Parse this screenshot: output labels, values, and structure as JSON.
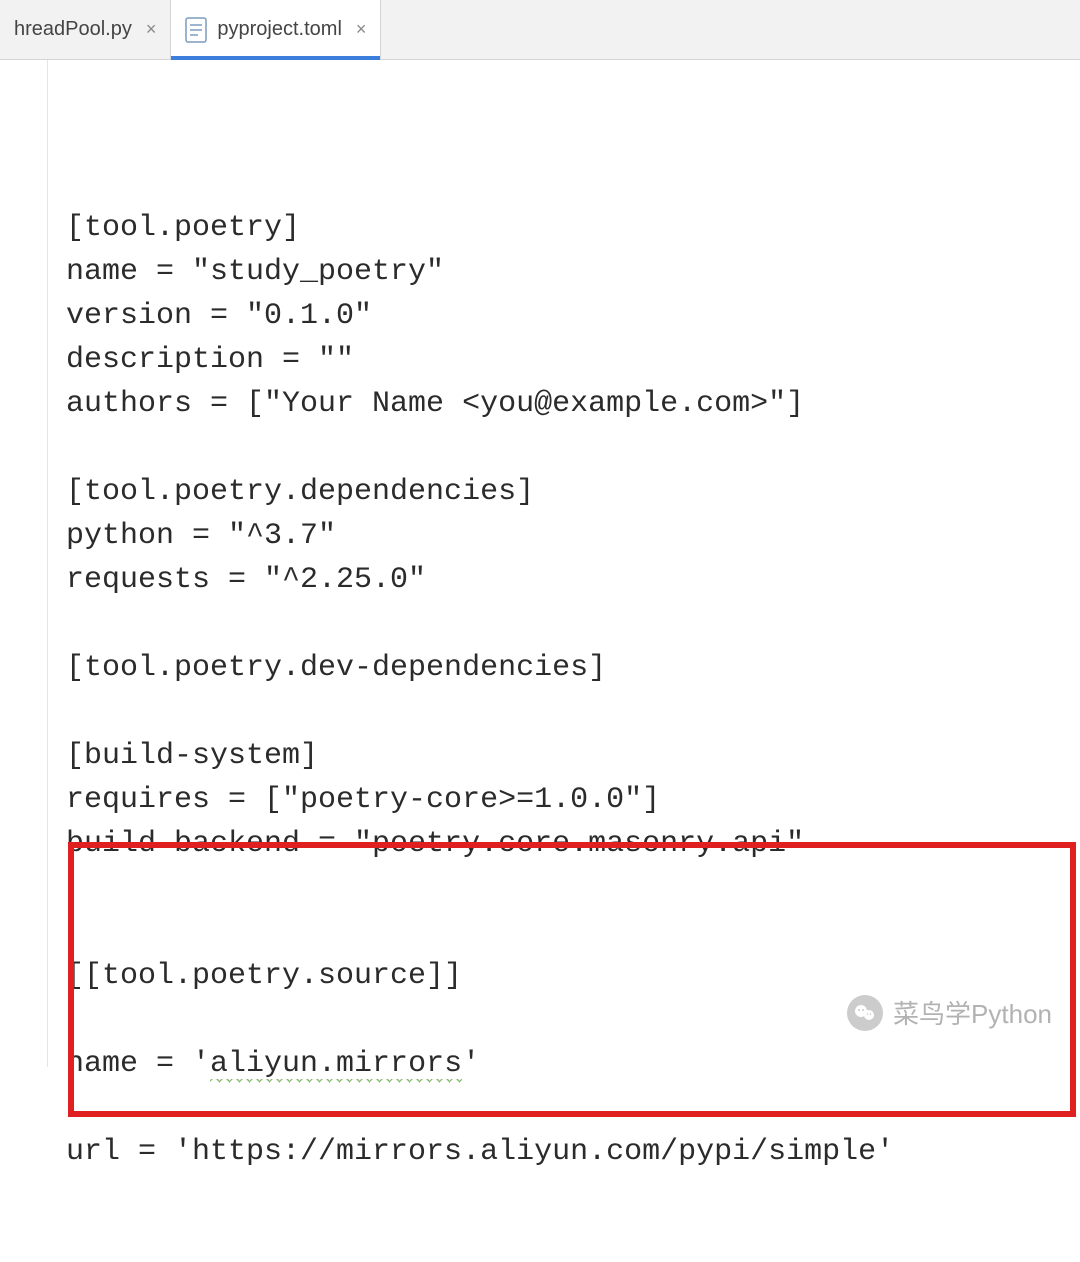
{
  "tabs": [
    {
      "label": "hreadPool.py",
      "active": false,
      "icon": "py-file-icon"
    },
    {
      "label": "pyproject.toml",
      "active": true,
      "icon": "toml-file-icon"
    }
  ],
  "code": {
    "lines": [
      "[tool.poetry]",
      "name = \"study_poetry\"",
      "version = \"0.1.0\"",
      "description = \"\"",
      "authors = [\"Your Name <you@example.com>\"]",
      "",
      "[tool.poetry.dependencies]",
      "python = \"^3.7\"",
      "requests = \"^2.25.0\"",
      "",
      "[tool.poetry.dev-dependencies]",
      "",
      "[build-system]",
      "requires = [\"poetry-core>=1.0.0\"]",
      "build-backend = \"poetry.core.masonry.api\"",
      "",
      "",
      "[[tool.poetry.source]]",
      "",
      "name = 'aliyun.mirrors'",
      "",
      "url = 'https://mirrors.aliyun.com/pypi/simple'"
    ],
    "squiggle_line_index": 19,
    "squiggle_text": "aliyun.mirrors",
    "highlight_start_line": 17,
    "highlight_end_line": 21
  },
  "watermark": {
    "text": "菜鸟学Python"
  }
}
